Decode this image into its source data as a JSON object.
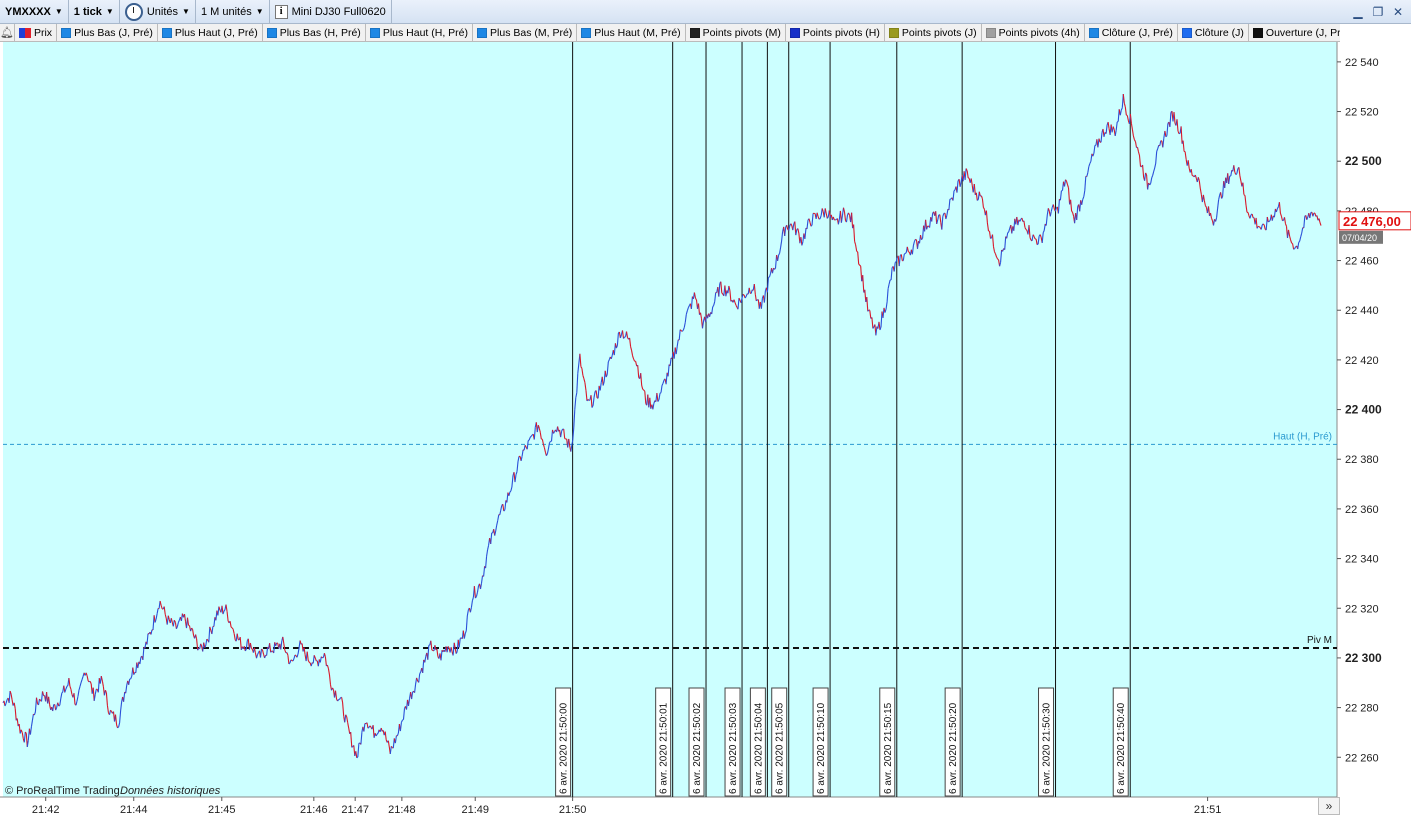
{
  "toolbar": {
    "symbol": "YMXXXX",
    "interval": "1 tick",
    "units": "Unités",
    "units_count": "1 M unités",
    "instrument": "Mini DJ30 Full0620"
  },
  "legend": [
    {
      "label": "Prix",
      "color": "split"
    },
    {
      "label": "Plus Bas (J, Pré)",
      "color": "#1e88e5"
    },
    {
      "label": "Plus Haut (J, Pré)",
      "color": "#1e88e5"
    },
    {
      "label": "Plus Bas (H, Pré)",
      "color": "#1e88e5"
    },
    {
      "label": "Plus Haut (H, Pré)",
      "color": "#1e88e5"
    },
    {
      "label": "Plus Bas (M, Pré)",
      "color": "#1e88e5"
    },
    {
      "label": "Plus Haut (M, Pré)",
      "color": "#1e88e5"
    },
    {
      "label": "Points pivots (M)",
      "color": "#222222"
    },
    {
      "label": "Points pivots (H)",
      "color": "#1730c8"
    },
    {
      "label": "Points pivots (J)",
      "color": "#9a9a1e"
    },
    {
      "label": "Points pivots (4h)",
      "color": "#a0a0a0"
    },
    {
      "label": "Clôture (J, Pré)",
      "color": "#1e88e5"
    },
    {
      "label": "Clôture (J)",
      "color": "#1e6cf0"
    },
    {
      "label": "Ouverture (J, Pré)",
      "color": "#111111"
    }
  ],
  "colors": {
    "background": "#ccffff",
    "price_up": "#2a4fd8",
    "price_down": "#d8182a",
    "current_price": "#e01010",
    "haut_line": "#2a9ad0"
  },
  "chart_data": {
    "type": "line",
    "title": "",
    "y_ticks": [
      22260,
      22280,
      22300,
      22320,
      22340,
      22360,
      22380,
      22400,
      22420,
      22440,
      22460,
      22480,
      22500,
      22520,
      22540
    ],
    "y_tick_labels": [
      "22 260",
      "22 280",
      "22 300",
      "22 320",
      "22 340",
      "22 360",
      "22 380",
      "22 400",
      "22 420",
      "22 440",
      "22 460",
      "22 480",
      "22 500",
      "22 520",
      "22 540"
    ],
    "ylim": [
      22244,
      22548
    ],
    "x_tick_labels": [
      "21:42",
      "21:44",
      "21:45",
      "21:46",
      "21:47",
      "21:48",
      "21:49",
      "21:50",
      "21:51"
    ],
    "current_price_label": "22 476,00",
    "current_date_label": "07/04/20",
    "reference_lines": [
      {
        "label": "Haut (H, Pré)",
        "value": 22386,
        "style": "dashed"
      },
      {
        "label": "Piv M",
        "value": 22304,
        "style": "dashed-bold"
      }
    ],
    "event_markers": [
      "6 avr. 2020 21:50:00",
      "6 avr. 2020 21:50:01",
      "6 avr. 2020 21:50:02",
      "6 avr. 2020 21:50:03",
      "6 avr. 2020 21:50:04",
      "6 avr. 2020 21:50:05",
      "6 avr. 2020 21:50:10",
      "6 avr. 2020 21:50:15",
      "6 avr. 2020 21:50:20",
      "6 avr. 2020 21:50:30",
      "6 avr. 2020 21:50:40"
    ],
    "price_path": [
      22282,
      22285,
      22272,
      22266,
      22281,
      22286,
      22279,
      22284,
      22290,
      22281,
      22296,
      22285,
      22291,
      22278,
      22274,
      22290,
      22296,
      22302,
      22311,
      22323,
      22315,
      22312,
      22316,
      22310,
      22303,
      22309,
      22318,
      22320,
      22311,
      22305,
      22306,
      22300,
      22303,
      22304,
      22306,
      22297,
      22305,
      22300,
      22298,
      22302,
      22288,
      22283,
      22270,
      22260,
      22276,
      22270,
      22273,
      22262,
      22270,
      22281,
      22289,
      22297,
      22305,
      22300,
      22305,
      22303,
      22310,
      22325,
      22330,
      22345,
      22355,
      22362,
      22372,
      22382,
      22387,
      22394,
      22383,
      22394,
      22390,
      22384,
      22421,
      22402,
      22405,
      22413,
      22422,
      22432,
      22428,
      22418,
      22404,
      22402,
      22408,
      22417,
      22428,
      22438,
      22446,
      22434,
      22440,
      22449,
      22448,
      22442,
      22446,
      22450,
      22440,
      22452,
      22461,
      22474,
      22474,
      22468,
      22476,
      22478,
      22480,
      22474,
      22479,
      22477,
      22459,
      22440,
      22430,
      22440,
      22456,
      22461,
      22464,
      22467,
      22474,
      22478,
      22475,
      22483,
      22491,
      22495,
      22488,
      22484,
      22469,
      22460,
      22470,
      22475,
      22476,
      22469,
      22468,
      22480,
      22480,
      22493,
      22476,
      22485,
      22499,
      22508,
      22514,
      22512,
      22525,
      22515,
      22501,
      22490,
      22501,
      22510,
      22519,
      22512,
      22496,
      22494,
      22481,
      22476,
      22488,
      22495,
      22498,
      22481,
      22476,
      22472,
      22478,
      22482,
      22470,
      22465,
      22475,
      22480,
      22476
    ],
    "x_ticks_pos": [
      0.032,
      0.098,
      0.164,
      0.233,
      0.264,
      0.299,
      0.354,
      0.427,
      0.903
    ],
    "markers_pos": [
      0.427,
      0.502,
      0.527,
      0.554,
      0.573,
      0.589,
      0.62,
      0.67,
      0.719,
      0.789,
      0.845
    ]
  },
  "footer": {
    "copyright": "© ProRealTime Trading",
    "data_note": "Données historiques"
  },
  "icons": [
    "bell-icon",
    "clock-icon",
    "info-icon",
    "minimize-icon",
    "restore-icon",
    "close-icon",
    "scroll-right-icon"
  ]
}
